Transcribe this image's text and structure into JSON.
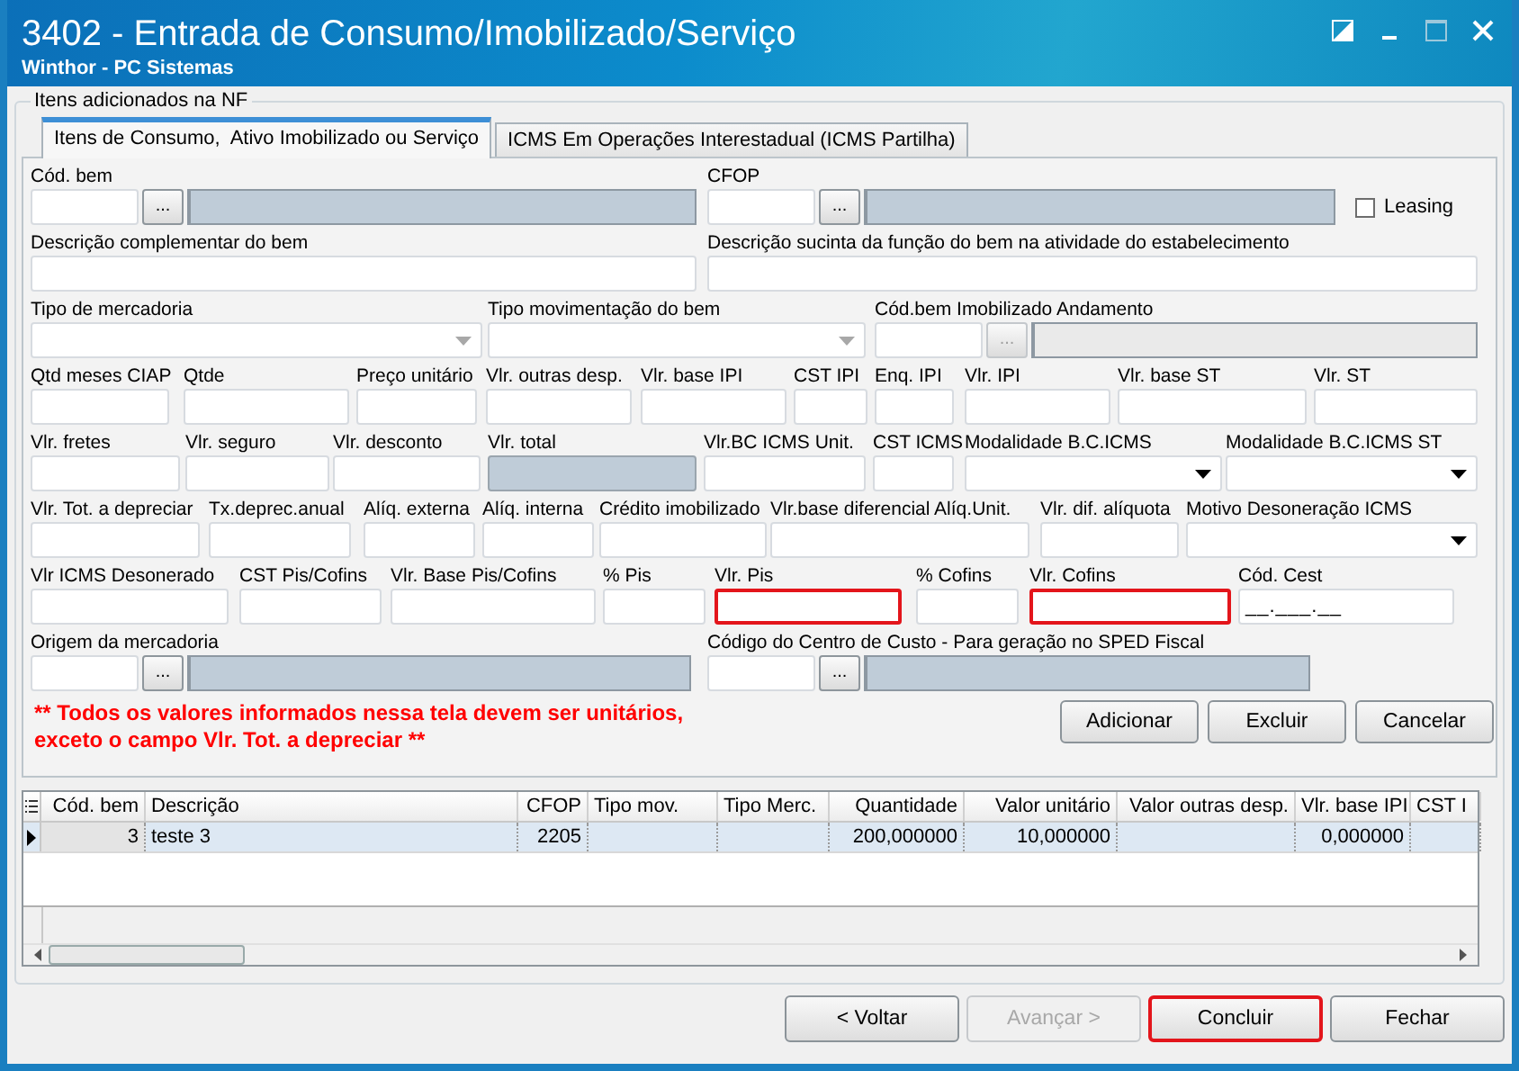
{
  "window": {
    "title": "3402 - Entrada de Consumo/Imobilizado/Serviço",
    "subtitle": "Winthor - PC Sistemas"
  },
  "group": {
    "title": "Itens adicionados na NF"
  },
  "tabs": [
    {
      "label": "Itens de Consumo,  Ativo Imobilizado ou Serviço",
      "selected": true
    },
    {
      "label": "ICMS Em Operações Interestadual (ICMS Partilha)",
      "selected": false
    }
  ],
  "form_rows": [
    [
      {
        "label": "Cód. bem",
        "kind": "lookup",
        "button_label": "...",
        "disabled": false
      },
      {
        "label": "CFOP",
        "kind": "lookup",
        "button_label": "...",
        "disabled": false
      },
      {
        "label": "Leasing",
        "kind": "checkbox",
        "checked": false
      }
    ],
    [
      {
        "label": "Descrição complementar do bem",
        "kind": "text",
        "disabled": false,
        "highlighted": false
      },
      {
        "label": "Descrição sucinta da função do bem na atividade do estabelecimento",
        "kind": "text",
        "disabled": false,
        "highlighted": false
      }
    ],
    [
      {
        "label": "Tipo de mercadoria",
        "kind": "combo",
        "disabled": true
      },
      {
        "label": "Tipo movimentação do bem",
        "kind": "combo",
        "disabled": true
      },
      {
        "label": "Cód.bem Imobilizado Andamento",
        "kind": "lookup",
        "button_label": "...",
        "disabled": true
      }
    ],
    [
      {
        "label": "Qtd meses CIAP",
        "kind": "text",
        "disabled": false,
        "highlighted": false
      },
      {
        "label": "Qtde",
        "kind": "text",
        "disabled": false,
        "highlighted": false
      },
      {
        "label": "Preço unitário",
        "kind": "text",
        "disabled": false,
        "highlighted": false
      },
      {
        "label": "Vlr. outras desp.",
        "kind": "text",
        "disabled": false,
        "highlighted": false
      },
      {
        "label": "Vlr. base IPI",
        "kind": "text",
        "disabled": false,
        "highlighted": false
      },
      {
        "label": "CST IPI",
        "kind": "text",
        "disabled": false,
        "highlighted": false
      },
      {
        "label": "Enq. IPI",
        "kind": "text",
        "disabled": false,
        "highlighted": false
      },
      {
        "label": "Vlr. IPI",
        "kind": "text",
        "disabled": false,
        "highlighted": false
      },
      {
        "label": "Vlr. base ST",
        "kind": "text",
        "disabled": false,
        "highlighted": false
      },
      {
        "label": "Vlr. ST",
        "kind": "text",
        "disabled": false,
        "highlighted": false
      }
    ],
    [
      {
        "label": "Vlr. fretes",
        "kind": "text",
        "disabled": false,
        "highlighted": false
      },
      {
        "label": "Vlr. seguro",
        "kind": "text",
        "disabled": false,
        "highlighted": false
      },
      {
        "label": "Vlr. desconto",
        "kind": "text",
        "disabled": false,
        "highlighted": false
      },
      {
        "label": "Vlr. total",
        "kind": "text",
        "disabled": true,
        "highlighted": false
      },
      {
        "label": "Vlr.BC ICMS Unit.",
        "kind": "text",
        "disabled": false,
        "highlighted": false
      },
      {
        "label": "CST ICMS",
        "kind": "text",
        "disabled": false,
        "highlighted": false
      },
      {
        "label": "Modalidade B.C.ICMS",
        "kind": "combo",
        "disabled": false
      },
      {
        "label": "Modalidade B.C.ICMS ST",
        "kind": "combo",
        "disabled": false
      }
    ],
    [
      {
        "label": "Vlr. Tot. a depreciar",
        "kind": "text",
        "disabled": false,
        "highlighted": false
      },
      {
        "label": "Tx.deprec.anual",
        "kind": "text",
        "disabled": false,
        "highlighted": false
      },
      {
        "label": "Alíq. externa",
        "kind": "text",
        "disabled": false,
        "highlighted": false
      },
      {
        "label": "Alíq. interna",
        "kind": "text",
        "disabled": false,
        "highlighted": false
      },
      {
        "label": "Crédito imobilizado",
        "kind": "text",
        "disabled": false,
        "highlighted": false
      },
      {
        "label": "Vlr.base diferencial Alíq.Unit.",
        "kind": "text",
        "disabled": false,
        "highlighted": false
      },
      {
        "label": "Vlr. dif. alíquota",
        "kind": "text",
        "disabled": false,
        "highlighted": false
      },
      {
        "label": "Motivo Desoneração ICMS",
        "kind": "combo",
        "disabled": false
      }
    ],
    [
      {
        "label": "Vlr ICMS Desonerado",
        "kind": "text",
        "disabled": false,
        "highlighted": false
      },
      {
        "label": "CST Pis/Cofins",
        "kind": "text",
        "disabled": false,
        "highlighted": false
      },
      {
        "label": "Vlr. Base Pis/Cofins",
        "kind": "text",
        "disabled": false,
        "highlighted": false
      },
      {
        "label": "% Pis",
        "kind": "text",
        "disabled": false,
        "highlighted": false
      },
      {
        "label": "Vlr. Pis",
        "kind": "text",
        "disabled": false,
        "highlighted": true
      },
      {
        "label": "% Cofins",
        "kind": "text",
        "disabled": false,
        "highlighted": false
      },
      {
        "label": "Vlr. Cofins",
        "kind": "text",
        "disabled": false,
        "highlighted": true
      },
      {
        "label": "Cód. Cest",
        "kind": "text",
        "value": "__.___.__",
        "disabled": false,
        "highlighted": false
      }
    ],
    [
      {
        "label": "Origem da mercadoria",
        "kind": "lookup",
        "button_label": "...",
        "disabled": false
      },
      {
        "label": "Código do Centro de Custo - Para geração no SPED Fiscal",
        "kind": "lookup",
        "button_label": "...",
        "disabled": false
      }
    ]
  ],
  "note": [
    "** Todos os valores informados nessa tela devem ser unitários,",
    "exceto o campo Vlr. Tot. a depreciar **"
  ],
  "form_buttons": [
    "Adicionar",
    "Excluir",
    "Cancelar"
  ],
  "table": {
    "columns": [
      {
        "label": "Cód. bem",
        "numeric": true
      },
      {
        "label": "Descrição",
        "numeric": false
      },
      {
        "label": "CFOP",
        "numeric": true
      },
      {
        "label": "Tipo mov.",
        "numeric": false
      },
      {
        "label": "Tipo Merc.",
        "numeric": false
      },
      {
        "label": "Quantidade",
        "numeric": true
      },
      {
        "label": "Valor unitário",
        "numeric": true
      },
      {
        "label": "Valor outras desp.",
        "numeric": true
      },
      {
        "label": "Vlr. base IPI",
        "numeric": true
      },
      {
        "label": "CST I",
        "numeric": false
      }
    ],
    "rows": [
      {
        "selected": true,
        "cells": [
          "3",
          "teste 3",
          "2205",
          null,
          null,
          "200,000000",
          "10,000000",
          null,
          "0,000000",
          null
        ]
      }
    ]
  },
  "footer_buttons": [
    {
      "label": "< Voltar",
      "disabled": false,
      "highlighted": false
    },
    {
      "label": "Avançar >",
      "disabled": true,
      "highlighted": false
    },
    {
      "label": "Concluir",
      "disabled": false,
      "highlighted": true
    },
    {
      "label": "Fechar",
      "disabled": false,
      "highlighted": false
    }
  ]
}
